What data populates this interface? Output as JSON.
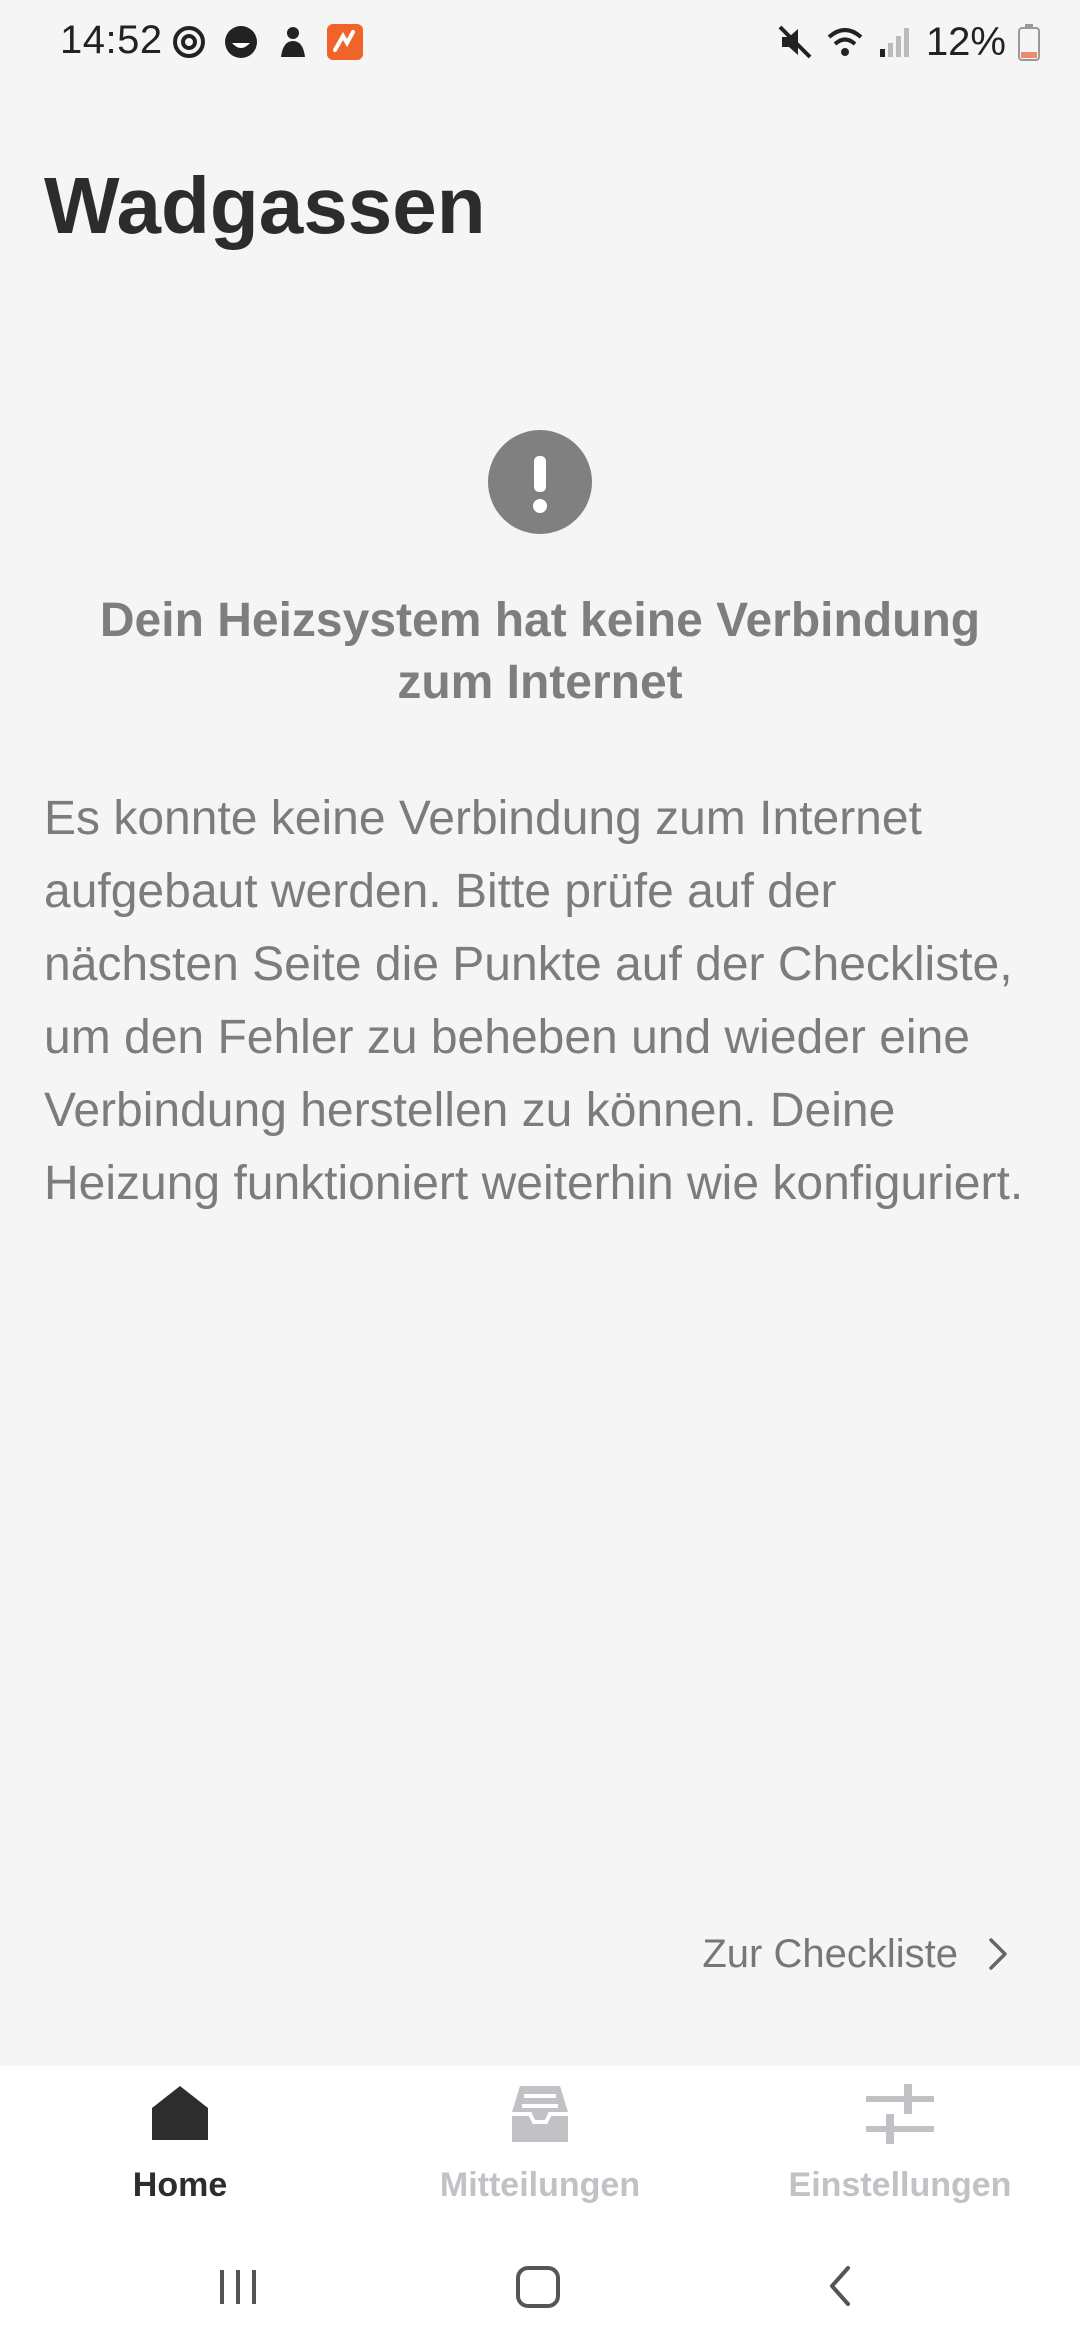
{
  "status_bar": {
    "time": "14:52",
    "left_icons": [
      "sync-icon",
      "face-icon",
      "user-icon",
      "app-notification-icon"
    ],
    "right_icons": [
      "mute-icon",
      "wifi-icon",
      "signal-icon",
      "battery-icon"
    ],
    "battery": "12%",
    "battery_color": "#f08a6a"
  },
  "page": {
    "title": "Wadgassen"
  },
  "alert": {
    "icon": "alert-icon",
    "heading": "Dein Heizsystem hat keine Verbindung zum Internet",
    "body": "Es konnte keine Verbindung zum Internet aufgebaut werden. Bitte prüfe auf der nächsten Seite die Punkte auf der Checkliste, um den Fehler zu beheben und wieder eine Verbindung herstellen zu können. Deine Heizung funktioniert weiterhin wie konfiguriert."
  },
  "checklist_link": {
    "label": "Zur Checkliste",
    "icon": "chevron-right-icon"
  },
  "bottom_nav": {
    "items": [
      {
        "label": "Home",
        "icon": "home-icon",
        "active": true
      },
      {
        "label": "Mitteilungen",
        "icon": "inbox-icon",
        "active": false
      },
      {
        "label": "Einstellungen",
        "icon": "sliders-icon",
        "active": false
      }
    ]
  },
  "system_nav": {
    "items": [
      "recents-icon",
      "home-button-icon",
      "back-icon"
    ]
  },
  "colors": {
    "background": "#f5f5f5",
    "title": "#2c2c2c",
    "muted_text": "#7c7c7c",
    "inactive_nav": "#c2c2c6"
  }
}
